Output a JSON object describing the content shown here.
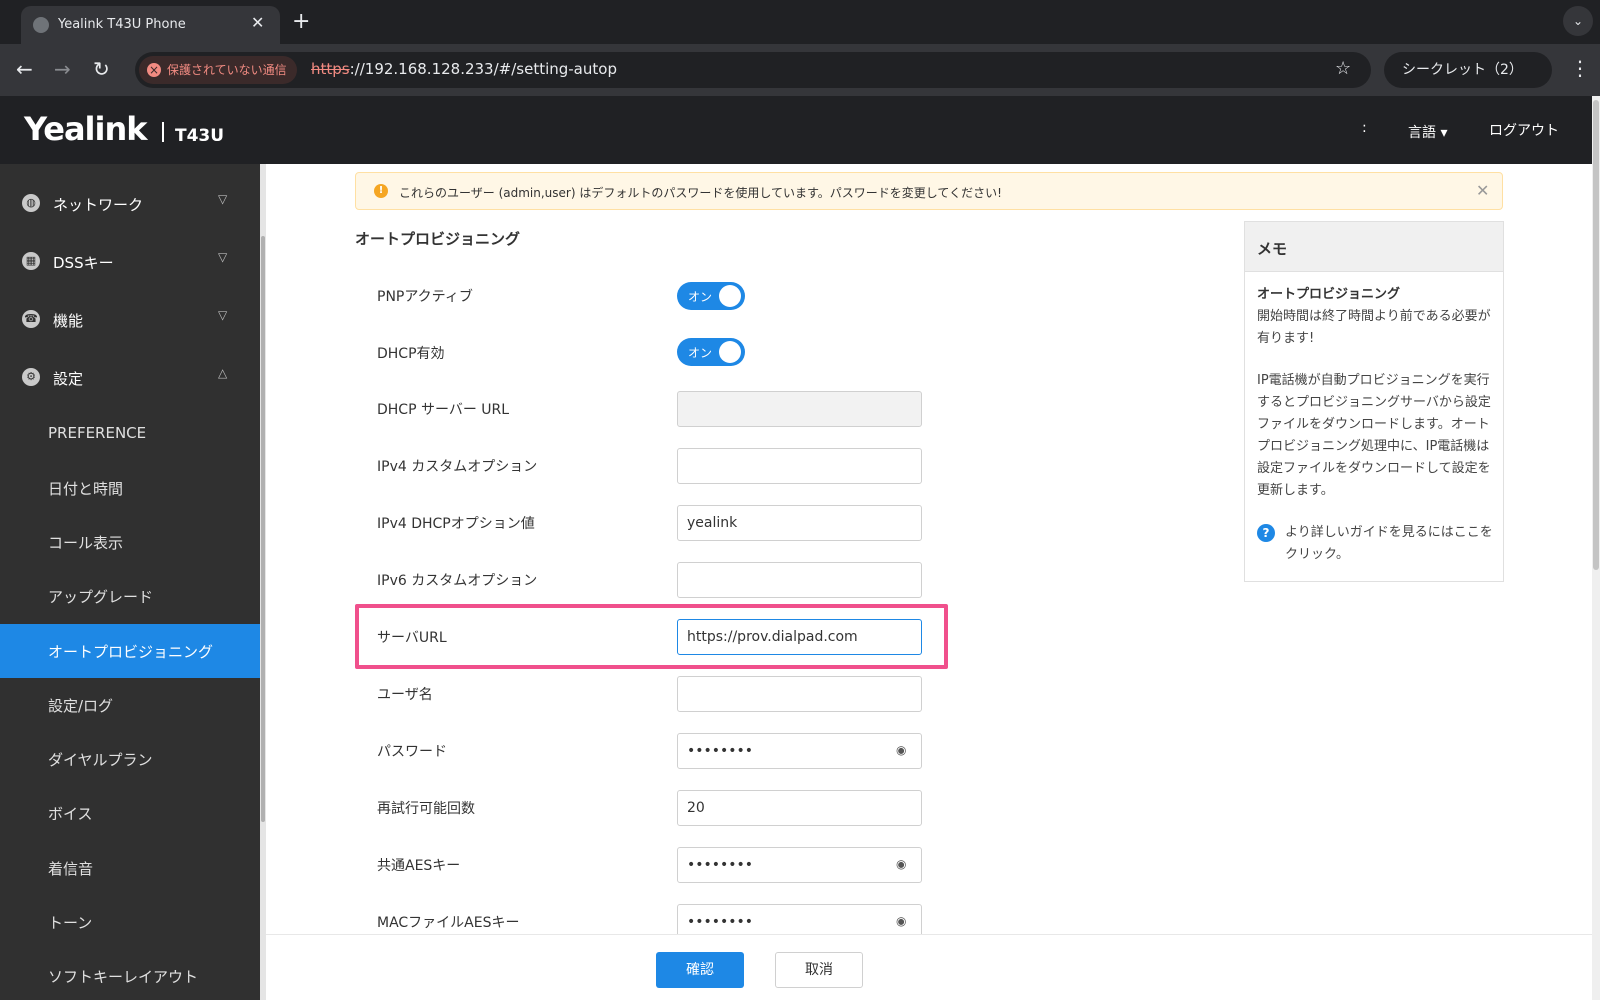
{
  "browser": {
    "tab_title": "Yealink T43U Phone",
    "insecure_label": "保護されていない通信",
    "url_scheme": "https",
    "url_rest": "://192.168.128.233/#/setting-autop",
    "incognito_label": "シークレット（2）"
  },
  "header": {
    "brand": "Yealink",
    "model": "T43U",
    "colon": ":",
    "language": "言語 ▾",
    "logout": "ログアウト"
  },
  "sidebar": {
    "sections": [
      {
        "label": "ネットワーク",
        "icon": "globe-icon",
        "expanded": false
      },
      {
        "label": "DSSキー",
        "icon": "grid-icon",
        "expanded": false
      },
      {
        "label": "機能",
        "icon": "phone-icon",
        "expanded": false
      },
      {
        "label": "設定",
        "icon": "gear-icon",
        "expanded": true
      }
    ],
    "items": [
      {
        "label": "PREFERENCE"
      },
      {
        "label": "日付と時間"
      },
      {
        "label": "コール表示"
      },
      {
        "label": "アップグレード"
      },
      {
        "label": "オートプロビジョニング",
        "active": true
      },
      {
        "label": "設定/ログ"
      },
      {
        "label": "ダイヤルプラン"
      },
      {
        "label": "ボイス"
      },
      {
        "label": "着信音"
      },
      {
        "label": "トーン"
      },
      {
        "label": "ソフトキーレイアウト"
      }
    ]
  },
  "warning": {
    "text": "これらのユーザー (admin,user) はデフォルトのパスワードを使用しています。パスワードを変更してください!"
  },
  "form": {
    "title": "オートプロビジョニング",
    "fields": [
      {
        "label": "PNPアクティブ",
        "type": "toggle",
        "value": "オン"
      },
      {
        "label": "DHCP有効",
        "type": "toggle",
        "value": "オン"
      },
      {
        "label": "DHCP サーバー URL",
        "type": "text",
        "value": "",
        "disabled": true
      },
      {
        "label": "IPv4 カスタムオプション",
        "type": "text",
        "value": ""
      },
      {
        "label": "IPv4 DHCPオプション値",
        "type": "text",
        "value": "yealink"
      },
      {
        "label": "IPv6 カスタムオプション",
        "type": "text",
        "value": ""
      },
      {
        "label": "サーバURL",
        "type": "text",
        "value": "https://prov.dialpad.com",
        "focused": true
      },
      {
        "label": "ユーザ名",
        "type": "text",
        "value": ""
      },
      {
        "label": "パスワード",
        "type": "password",
        "value": "••••••••"
      },
      {
        "label": "再試行可能回数",
        "type": "text",
        "value": "20"
      },
      {
        "label": "共通AESキー",
        "type": "password",
        "value": "••••••••"
      },
      {
        "label": "MACファイルAESキー",
        "type": "password",
        "value": "••••••••"
      }
    ],
    "confirm_label": "確認",
    "cancel_label": "取消"
  },
  "memo": {
    "title": "メモ",
    "subtitle": "オートプロビジョニング",
    "line1": "開始時間は終了時間より前である必要が有ります!",
    "line2": "IP電話機が自動プロビジョニングを実行するとプロビジョニングサーバから設定ファイルをダウンロードします。オートプロビジョニング処理中に、IP電話機は設定ファイルをダウンロードして設定を更新します。",
    "help": "より詳しいガイドを見るにはここをクリック。"
  },
  "colors": {
    "accent": "#1e88e5",
    "highlight": "#f0508c",
    "sidebar": "#303030"
  }
}
